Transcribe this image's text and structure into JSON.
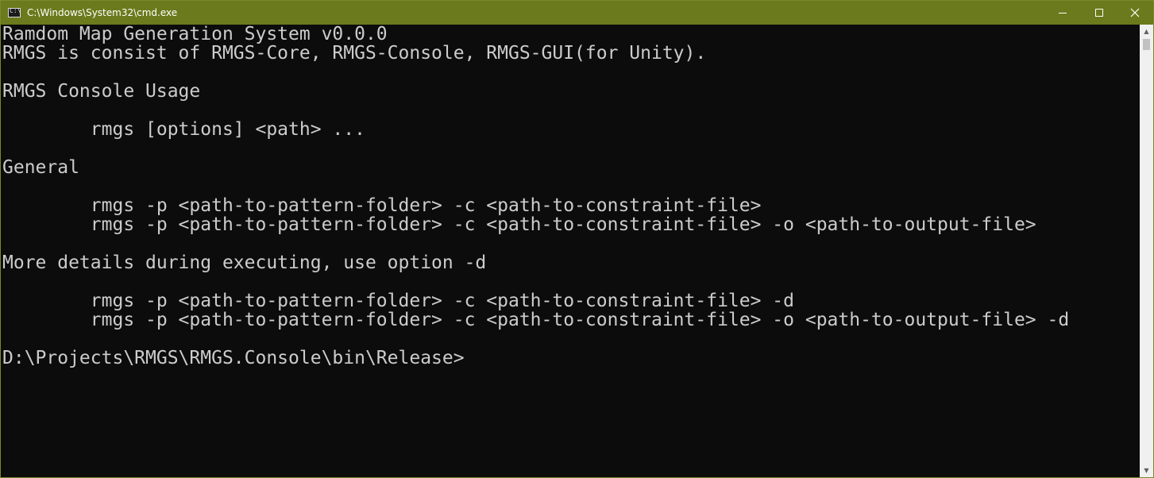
{
  "window": {
    "title": "C:\\Windows\\System32\\cmd.exe",
    "accent_color": "#6b7a1c",
    "icon": "cmd-icon",
    "icon_text": "C:\\",
    "controls": {
      "minimize_icon": "minimize-icon",
      "maximize_icon": "maximize-icon",
      "close_icon": "close-icon"
    }
  },
  "console": {
    "background": "#0c0c0c",
    "foreground": "#cccccc",
    "lines": [
      "Ramdom Map Generation System v0.0.0",
      "RMGS is consist of RMGS-Core, RMGS-Console, RMGS-GUI(for Unity).",
      "",
      "RMGS Console Usage",
      "",
      "        rmgs [options] <path> ...",
      "",
      "General",
      "",
      "        rmgs -p <path-to-pattern-folder> -c <path-to-constraint-file>",
      "        rmgs -p <path-to-pattern-folder> -c <path-to-constraint-file> -o <path-to-output-file>",
      "",
      "More details during executing, use option -d",
      "",
      "        rmgs -p <path-to-pattern-folder> -c <path-to-constraint-file> -d",
      "        rmgs -p <path-to-pattern-folder> -c <path-to-constraint-file> -o <path-to-output-file> -d",
      "",
      "D:\\Projects\\RMGS\\RMGS.Console\\bin\\Release>"
    ]
  },
  "scrollbar": {
    "up_icon": "scroll-up-arrow-icon",
    "down_icon": "scroll-down-arrow-icon",
    "up_glyph": "▲",
    "down_glyph": "▼"
  }
}
